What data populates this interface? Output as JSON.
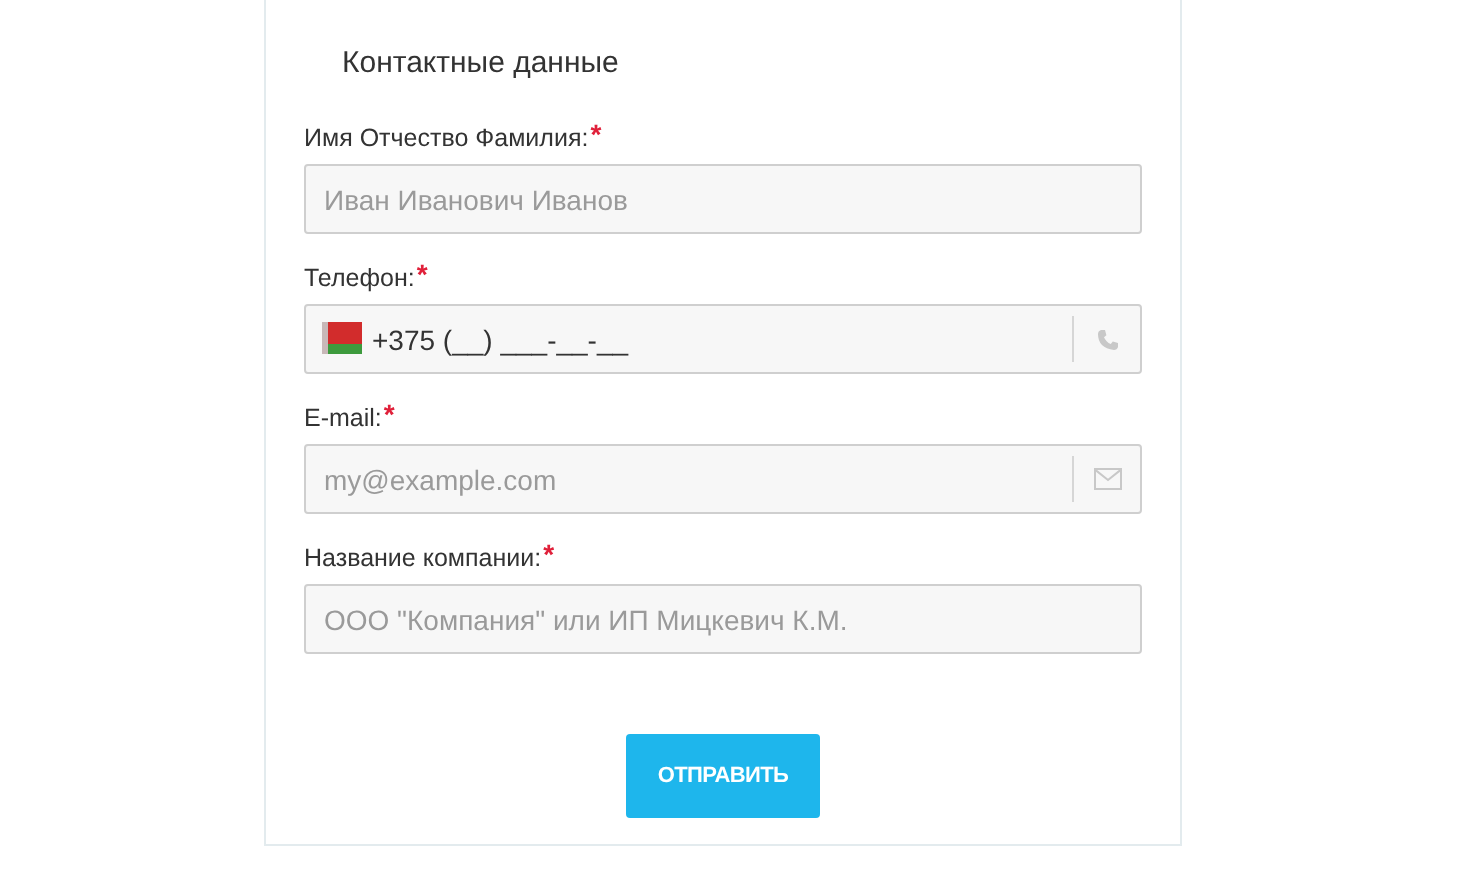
{
  "form": {
    "title": "Контактные данные",
    "fields": [
      {
        "kind": "text",
        "label": "Имя Отчество Фамилия:",
        "required_mark": "*",
        "placeholder": "Иван Иванович Иванов"
      },
      {
        "kind": "phone",
        "label": "Телефон:",
        "required_mark": "*",
        "value": "+375 (__) ___-__-__"
      },
      {
        "kind": "email",
        "label": "E-mail:",
        "required_mark": "*",
        "placeholder": "my@example.com"
      },
      {
        "kind": "text",
        "label": "Название компании:",
        "required_mark": "*",
        "placeholder": "ООО \"Компания\" или ИП Мицкевич К.М."
      }
    ],
    "submit": "ОТПРАВИТЬ"
  }
}
